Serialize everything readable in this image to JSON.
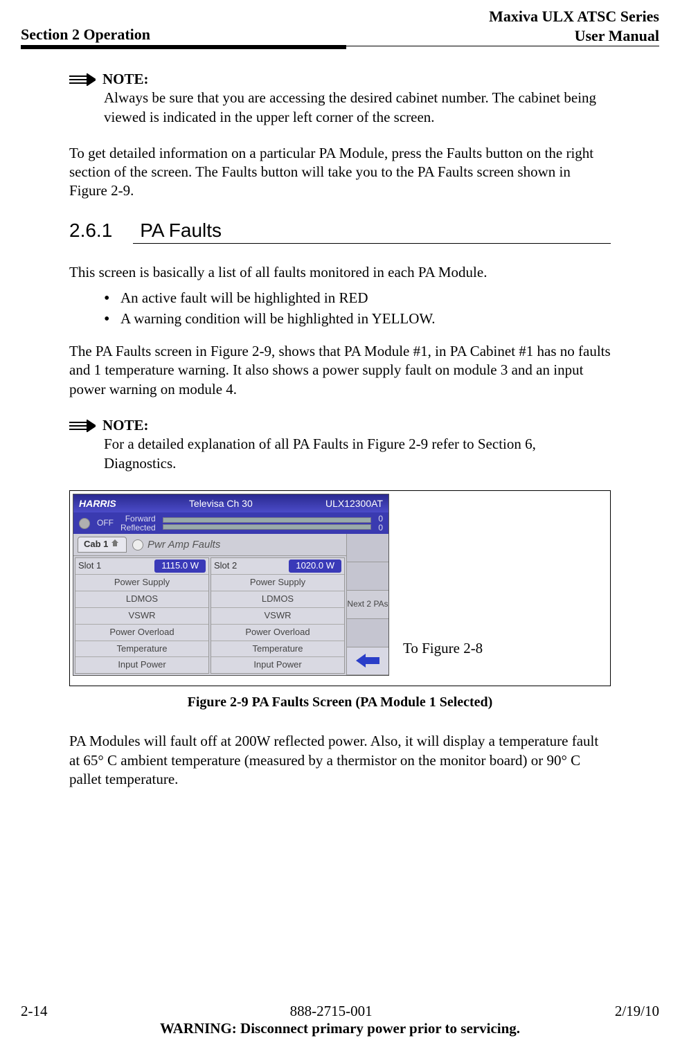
{
  "header": {
    "section": "Section 2 Operation",
    "series": "Maxiva ULX ATSC Series",
    "manual": "User Manual"
  },
  "note1": {
    "label": "NOTE:",
    "body": "Always be sure that you are accessing the desired cabinet number. The cabinet being viewed is indicated in the upper left corner of the screen."
  },
  "para1": "To get detailed information on a particular PA Module, press the Faults  button on the right section of the screen. The Faults button will take you to the PA Faults screen shown in Figure 2-9.",
  "section": {
    "num": "2.6.1",
    "title": "PA Faults"
  },
  "para2": "This screen is basically a list of all faults monitored in each PA Module.",
  "bullets": [
    "An active fault will be highlighted in RED",
    "A warning condition will be highlighted in YELLOW."
  ],
  "para3": "The PA Faults screen in Figure 2-9, shows that PA Module #1, in PA Cabinet #1 has no faults and 1 temperature warning. It also shows a power supply fault on module 3 and an input power warning on module 4.",
  "note2": {
    "label": "NOTE:",
    "body": "For a detailed explanation of all PA Faults in Figure 2-9 refer to Section 6, Diagnostics."
  },
  "device": {
    "logo": "HARRIS",
    "title_mid": "Televisa Ch 30",
    "title_right": "ULX12300AT",
    "off": "OFF",
    "fwd": "Forward",
    "ref": "Reflected",
    "fwd_val": "0",
    "ref_val": "0",
    "cab": "Cab 1",
    "screen_title": "Pwr Amp Faults",
    "slots": [
      {
        "title": "Slot 1",
        "value": "1115.0 W",
        "rows": [
          "Power Supply",
          "LDMOS",
          "VSWR",
          "Power Overload",
          "Temperature",
          "Input Power"
        ]
      },
      {
        "title": "Slot 2",
        "value": "1020.0 W",
        "rows": [
          "Power Supply",
          "LDMOS",
          "VSWR",
          "Power Overload",
          "Temperature",
          "Input Power"
        ]
      }
    ],
    "side_next": "Next 2 PAs"
  },
  "fig_label_side": "To Figure 2-8",
  "fig_caption": "Figure 2-9  PA Faults Screen (PA Module 1 Selected)",
  "para4": "PA Modules will fault off at 200W reflected power. Also, it will display a temperature fault at 65° C ambient temperature (measured by a thermistor on the monitor board) or 90° C pallet temperature.",
  "footer": {
    "page": "2-14",
    "doc": "888-2715-001",
    "date": "2/19/10",
    "warning": "WARNING: Disconnect primary power prior to servicing."
  }
}
